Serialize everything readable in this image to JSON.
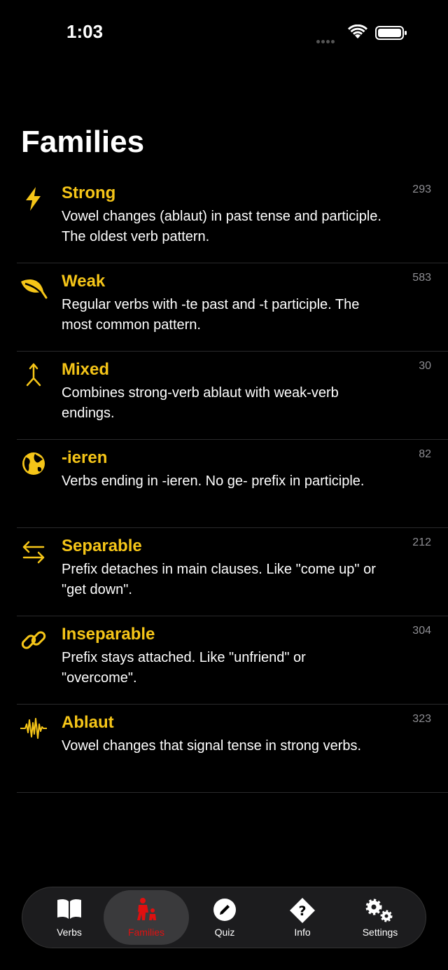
{
  "status": {
    "time": "1:03"
  },
  "page": {
    "title": "Families"
  },
  "families": [
    {
      "name": "Strong",
      "description": "Vowel changes (ablaut) in past tense and participle. The oldest verb pattern.",
      "count": "293",
      "icon": "bolt-icon"
    },
    {
      "name": "Weak",
      "description": "Regular verbs with -te past and -t participle. The most common pattern.",
      "count": "583",
      "icon": "leaf-icon"
    },
    {
      "name": "Mixed",
      "description": "Combines strong-verb ablaut with weak-verb endings.",
      "count": "30",
      "icon": "merge-arrow-icon"
    },
    {
      "name": "-ieren",
      "description": "Verbs ending in -ieren. No ge- prefix in participle.",
      "count": "82",
      "icon": "globe-icon"
    },
    {
      "name": "Separable",
      "description": "Prefix detaches in main clauses. Like \"come up\" or \"get down\".",
      "count": "212",
      "icon": "swap-arrows-icon"
    },
    {
      "name": "Inseparable",
      "description": "Prefix stays attached. Like \"unfriend\" or \"overcome\".",
      "count": "304",
      "icon": "link-icon"
    },
    {
      "name": "Ablaut",
      "description": "Vowel changes that signal tense in strong verbs.",
      "count": "323",
      "icon": "waveform-icon"
    }
  ],
  "tabs": [
    {
      "label": "Verbs",
      "icon": "book-icon"
    },
    {
      "label": "Families",
      "icon": "family-icon",
      "active": true
    },
    {
      "label": "Quiz",
      "icon": "pencil-circle-icon"
    },
    {
      "label": "Info",
      "icon": "question-diamond-icon"
    },
    {
      "label": "Settings",
      "icon": "gears-icon"
    }
  ],
  "colors": {
    "accent": "#f5c518",
    "active_tab": "#e01010",
    "background": "#000000"
  }
}
